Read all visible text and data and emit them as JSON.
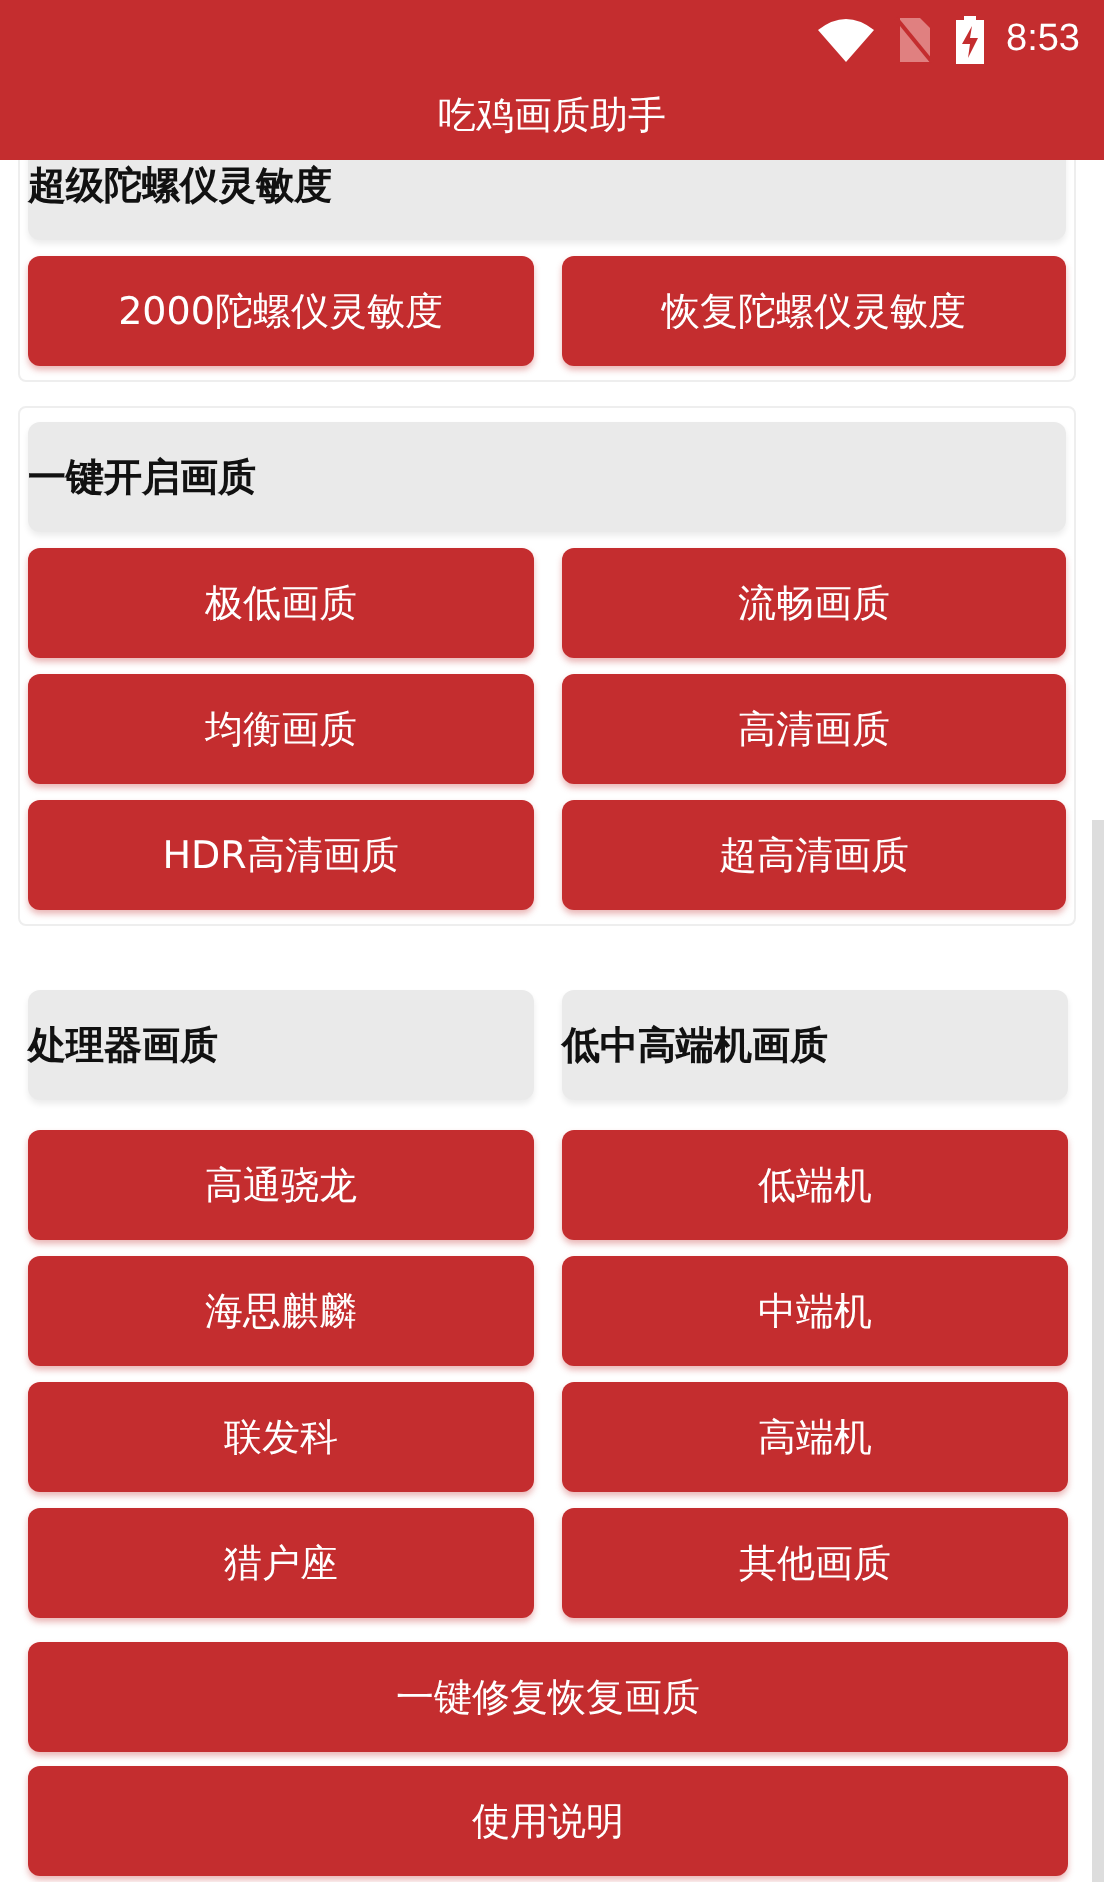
{
  "status_bar": {
    "time": "8:53"
  },
  "app_bar": {
    "title": "吃鸡画质助手"
  },
  "cards": [
    {
      "header": "超级陀螺仪灵敏度",
      "buttons": [
        "2000陀螺仪灵敏度",
        "恢复陀螺仪灵敏度"
      ]
    },
    {
      "header": "一键开启画质",
      "buttons": [
        "极低画质",
        "流畅画质",
        "均衡画质",
        "高清画质",
        "HDR高清画质",
        "超高清画质"
      ]
    }
  ],
  "columns": [
    {
      "header": "处理器画质",
      "buttons": [
        "高通骁龙",
        "海思麒麟",
        "联发科",
        "猎户座"
      ]
    },
    {
      "header": "低中高端机画质",
      "buttons": [
        "低端机",
        "中端机",
        "高端机",
        "其他画质"
      ]
    }
  ],
  "wide_buttons": [
    "一键修复恢复画质",
    "使用说明"
  ]
}
